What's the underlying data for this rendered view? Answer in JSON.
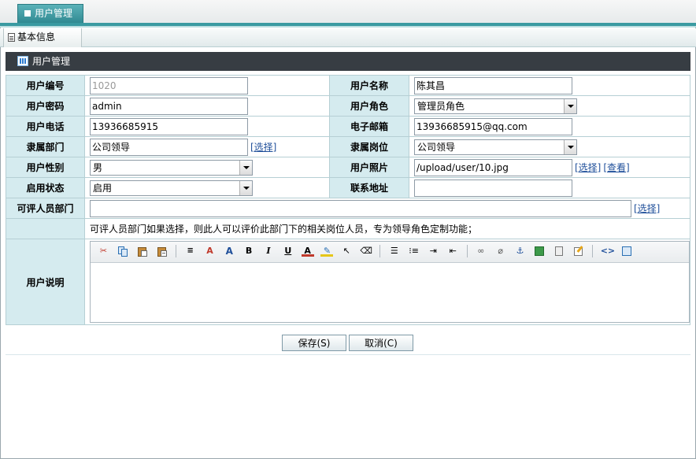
{
  "top_tab": {
    "label": "用户管理"
  },
  "sub_tab": {
    "label": "基本信息"
  },
  "panel": {
    "title": "用户管理"
  },
  "form": {
    "user_id_label": "用户编号",
    "user_id_value": "1020",
    "user_name_label": "用户名称",
    "user_name_value": "陈其昌",
    "password_label": "用户密码",
    "password_value": "admin",
    "role_label": "用户角色",
    "role_value": "管理员角色",
    "phone_label": "用户电话",
    "phone_value": "13936685915",
    "email_label": "电子邮箱",
    "email_value": "13936685915@qq.com",
    "dept_label": "隶属部门",
    "dept_value": "公司领导",
    "dept_link": "[选择]",
    "post_label": "隶属岗位",
    "post_value": "公司领导",
    "gender_label": "用户性别",
    "gender_value": "男",
    "photo_label": "用户照片",
    "photo_value": "/upload/user/10.jpg",
    "photo_select_link": "[选择]",
    "photo_view_link": "[查看]",
    "status_label": "启用状态",
    "status_value": "启用",
    "address_label": "联系地址",
    "address_value": "",
    "eval_dept_label": "可评人员部门",
    "eval_dept_value": "",
    "eval_dept_link": "[选择]",
    "eval_hint": "可评人员部门如果选择，则此人可以评价此部门下的相关岗位人员，专为领导角色定制功能；",
    "desc_label": "用户说明"
  },
  "toolbar_icons": [
    "cut-icon",
    "copy-icon",
    "paste-icon",
    "paste-text-icon",
    "format-icon",
    "spellcheck-icon",
    "font-size-icon",
    "bold-icon",
    "italic-icon",
    "underline-icon",
    "font-color-icon",
    "highlight-icon",
    "select-icon",
    "eraser-icon",
    "align-left-icon",
    "bullet-list-icon",
    "indent-icon",
    "outdent-icon",
    "link-icon",
    "unlink-icon",
    "anchor-icon",
    "image-icon",
    "flash-icon",
    "edit-icon",
    "source-code-icon",
    "preview-icon"
  ],
  "buttons": {
    "save": "保存(S)",
    "cancel": "取消(C)"
  },
  "colors": {
    "accent": "#3a9aa1",
    "header": "#373d43",
    "label_bg": "#d5ebef"
  }
}
